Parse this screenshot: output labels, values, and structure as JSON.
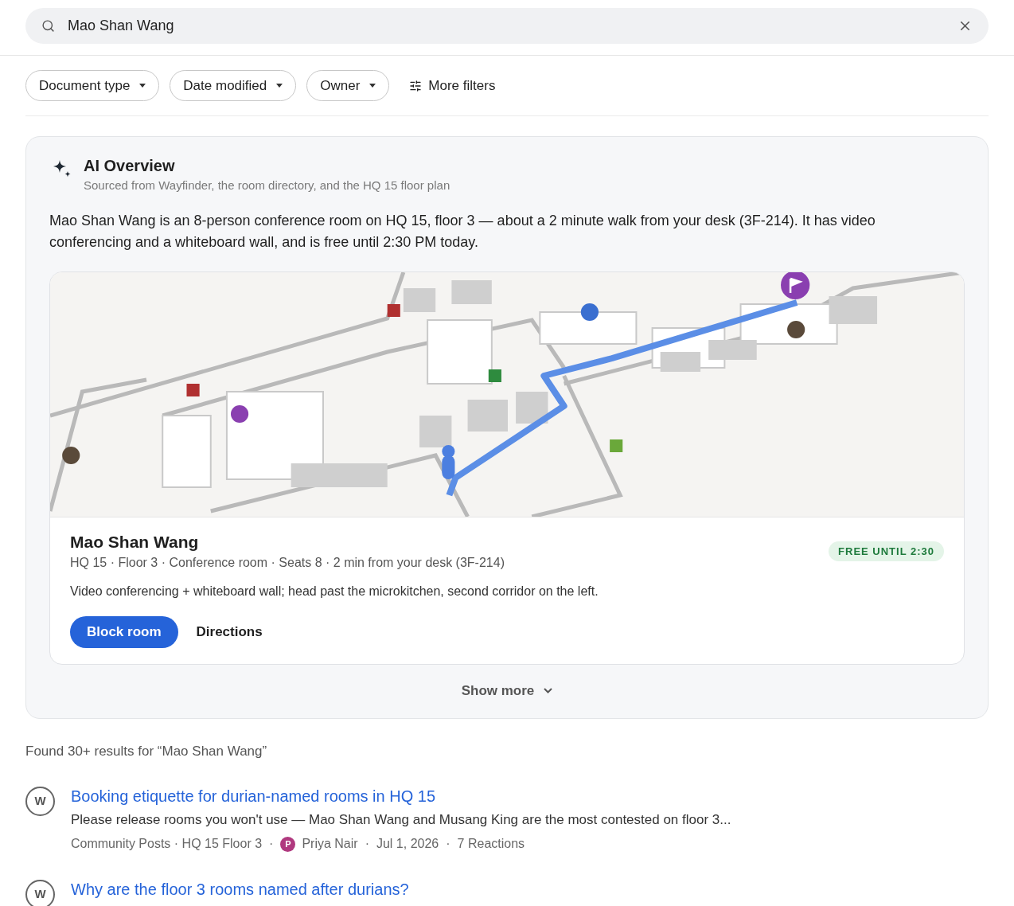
{
  "search": {
    "value": "Mao Shan Wang"
  },
  "filters": [
    {
      "kind": "dropdown",
      "label": "Document type"
    },
    {
      "kind": "dropdown",
      "label": "Date modified"
    },
    {
      "kind": "dropdown",
      "label": "Owner"
    },
    {
      "kind": "more",
      "label": "More filters"
    }
  ],
  "overview": {
    "title": "AI Overview",
    "subtitle": "Sourced from Wayfinder, the room directory, and the HQ 15 floor plan",
    "summary": "Mao Shan Wang is an 8-person conference room on HQ 15, floor 3 — about a 2 minute walk from your desk (3F-214). It has video conferencing and a whiteboard wall, and is free until 2:30 PM today.",
    "room": {
      "name": "Mao Shan Wang",
      "details": "HQ 15 · Floor 3 · Conference room · Seats 8 · 2 min from your desk (3F-214)",
      "status": "FREE UNTIL 2:30",
      "note": "Video conferencing + whiteboard wall; head past the microkitchen, second corridor on the left.",
      "actions": [
        {
          "kind": "primary",
          "label": "Block room"
        },
        {
          "kind": "plain",
          "label": "Directions"
        }
      ]
    },
    "show_more": "Show more"
  },
  "results_summary": "Found 30+ results for “Mao Shan Wang”",
  "results": [
    {
      "icon": "W",
      "title": "Booking etiquette for durian-named rooms in HQ 15",
      "snippet": "Please release rooms you won't use — Mao Shan Wang and Musang King are the most contested on floor 3...",
      "meta": [
        {
          "kind": "text",
          "text": "Community Posts · HQ 15 Floor 3"
        },
        {
          "kind": "sep",
          "text": "·"
        },
        {
          "kind": "author",
          "initial": "P",
          "text": "Priya Nair",
          "color": "#b0397f"
        },
        {
          "kind": "sep",
          "text": "·"
        },
        {
          "kind": "text",
          "text": "Jul 1, 2026"
        },
        {
          "kind": "sep",
          "text": "·"
        },
        {
          "kind": "text",
          "text": "7 Reactions"
        }
      ]
    },
    {
      "icon": "W",
      "title": "Why are the floor 3 rooms named after durians?"
    }
  ]
}
